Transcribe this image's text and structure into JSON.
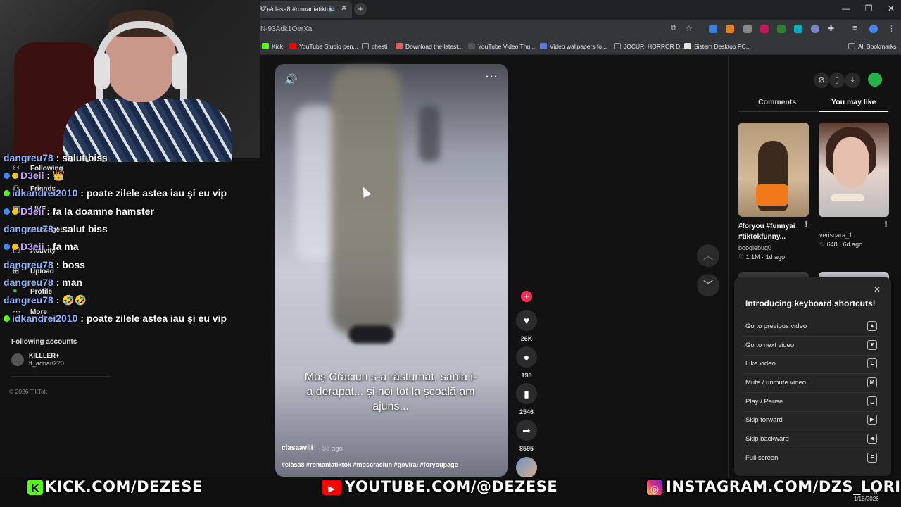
{
  "browser": {
    "active_tab_title": "3Z)#clasa8 #romaniatiktok",
    "url_fragment": "N-93Adk1OerXa",
    "bookmarks": [
      {
        "label": "Kick",
        "color": "#53fc18"
      },
      {
        "label": "YouTube Studio pen...",
        "color": "#ff0000"
      },
      {
        "label": "chesti",
        "color": "#9aa0a6"
      },
      {
        "label": "Download the latest...",
        "color": "#e25b5b"
      },
      {
        "label": "YouTube Video Thu...",
        "color": "#222222"
      },
      {
        "label": "Video wallpapers fo...",
        "color": "#5b7be2"
      },
      {
        "label": "JOCURI HORROR D...",
        "color": "#9aa0a6"
      },
      {
        "label": "Sistem Desktop PC...",
        "color": "#e6e6e6"
      }
    ],
    "all_bookmarks": "All Bookmarks"
  },
  "sidebar": {
    "items": [
      {
        "label": "Following",
        "icon": "following-icon"
      },
      {
        "label": "Friends",
        "icon": "friends-icon"
      },
      {
        "label": "LIVE",
        "icon": "live-icon"
      },
      {
        "label": "Messages",
        "icon": "messages-icon"
      },
      {
        "label": "Activity",
        "icon": "activity-icon"
      },
      {
        "label": "Upload",
        "icon": "upload-icon"
      },
      {
        "label": "Profile",
        "icon": "profile-icon"
      },
      {
        "label": "More",
        "icon": "more-icon"
      }
    ],
    "following_accounts_title": "Following accounts",
    "account": {
      "name": "KILLLER+",
      "handle": "ff_adrian220"
    },
    "copyright": "© 2026 TikTok"
  },
  "chat": [
    {
      "user": "dangreu78",
      "message": "salut biss",
      "color": "#8fb4ff"
    },
    {
      "user": "D3eii",
      "message": "👑",
      "color": "#c8a0ff"
    },
    {
      "user": "idkandrei2010",
      "message": "poate zilele astea iau și eu vip",
      "color": "#8fb4ff"
    },
    {
      "user": "D3eii",
      "message": "fa la doamne hamster",
      "color": "#c8a0ff"
    },
    {
      "user": "dangreu78",
      "message": "salut biss",
      "color": "#8fb4ff"
    },
    {
      "user": "D3eii",
      "message": "fa ma",
      "color": "#c8a0ff"
    },
    {
      "user": "dangreu78",
      "message": "boss",
      "color": "#8fb4ff"
    },
    {
      "user": "dangreu78",
      "message": "man",
      "color": "#8fb4ff"
    },
    {
      "user": "dangreu78",
      "message": "🤣🤣",
      "color": "#8fb4ff"
    },
    {
      "user": "idkandrei2010",
      "message": "poate zilele astea iau și eu vip",
      "color": "#8fb4ff"
    }
  ],
  "video": {
    "caption": "Moș Crăciun s-a răsturnat, sania i-a derapat... și noi tot la școală am ajuns...",
    "author": "clasaaviii",
    "age": "· 3d ago",
    "tags": "#clasa8 #romaniatiktok #moscraciun #goviral #foryoupage",
    "likes": "26K",
    "comments": "198",
    "saves": "2546",
    "shares": "8595"
  },
  "right_panel": {
    "tabs": {
      "comments": "Comments",
      "you_may_like": "You may like"
    },
    "thumbs": [
      {
        "title_line1": "#foryou #funnyai",
        "title_line2": "#tiktokfunny...",
        "author": "boogiebug0",
        "likes": "1.1M",
        "age": "1d ago"
      },
      {
        "title_line1": "",
        "title_line2": "",
        "author": "verisoara_1",
        "likes": "648",
        "age": "6d ago"
      }
    ]
  },
  "shortcuts": {
    "title": "Introducing keyboard shortcuts!",
    "items": [
      {
        "label": "Go to previous video",
        "key": "▲"
      },
      {
        "label": "Go to next video",
        "key": "▼"
      },
      {
        "label": "Like video",
        "key": "L"
      },
      {
        "label": "Mute / unmute video",
        "key": "M"
      },
      {
        "label": "Play / Pause",
        "key": "␣"
      },
      {
        "label": "Skip forward",
        "key": "▶"
      },
      {
        "label": "Skip backward",
        "key": "◀"
      },
      {
        "label": "Full screen",
        "key": "F"
      }
    ]
  },
  "banners": {
    "kick": "KICK.COM/DEZESE",
    "youtube": "YOUTUBE.COM/@DEZESE",
    "instagram": "INSTAGRAM.COM/DZS_LORI"
  },
  "taskbar": {
    "time": "PM",
    "date": "1/18/2026"
  }
}
